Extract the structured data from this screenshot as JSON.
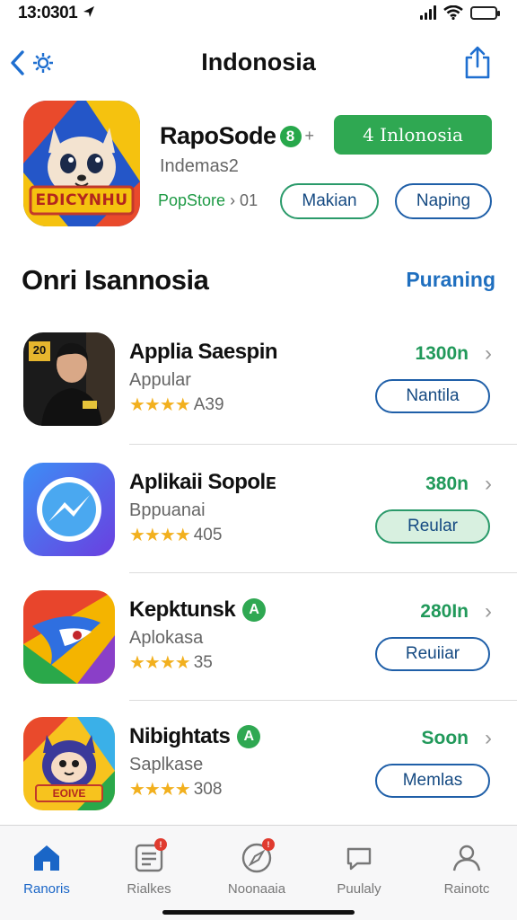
{
  "status_bar": {
    "time": "13:0301",
    "battery_color": "#2fb64a"
  },
  "nav": {
    "title": "Indonosia",
    "back_icon": "chevron-left-icon",
    "gear_icon": "gear-icon",
    "share_icon": "share-icon"
  },
  "hero": {
    "app_name": "RapoSode",
    "age_badge": "8",
    "age_plus": "+",
    "subtitle": "Indemas2",
    "store": "PopStore",
    "rank": " › 01",
    "icon_text": "EDICYNHU",
    "get_button": "4 Inlonosia",
    "pill_a": "Makian",
    "pill_b": "Naping",
    "accent": "#2fa852"
  },
  "section": {
    "title": "Onri Isannosia",
    "link": "Puraning",
    "link_color": "#1f6fbf"
  },
  "apps": [
    {
      "name": "Applia Saespin",
      "badge": "",
      "category": "Appular",
      "stars": "★★★★",
      "rating": "A39",
      "size": "1300n",
      "button": "Nantila",
      "filled": false,
      "icon_text": "20"
    },
    {
      "name": "Aplikaii Sopolᴇ",
      "badge": "",
      "category": "Bppuanai",
      "stars": "★★★★",
      "rating": "405",
      "size": "380n",
      "button": "Reular",
      "filled": true,
      "icon_text": ""
    },
    {
      "name": "Kepktunsk",
      "badge": "A",
      "category": "Aplokasa",
      "stars": "★★★★",
      "rating": "35",
      "size": "280In",
      "button": "Reuiiar",
      "filled": false,
      "icon_text": ""
    },
    {
      "name": "Nibightats",
      "badge": "A",
      "category": "Saplkase",
      "stars": "★★★★",
      "rating": "308",
      "size": "Soon",
      "button": "Memlas",
      "filled": false,
      "icon_text": "EOIVE"
    }
  ],
  "tabs": [
    {
      "label": "Ranoris",
      "icon": "home-icon",
      "badge": ""
    },
    {
      "label": "Rialkes",
      "icon": "list-icon",
      "badge": "!"
    },
    {
      "label": "Noonaaia",
      "icon": "compass-icon",
      "badge": "!"
    },
    {
      "label": "Puulaly",
      "icon": "chat-bubble-icon",
      "badge": ""
    },
    {
      "label": "Rainotc",
      "icon": "person-icon",
      "badge": ""
    }
  ]
}
